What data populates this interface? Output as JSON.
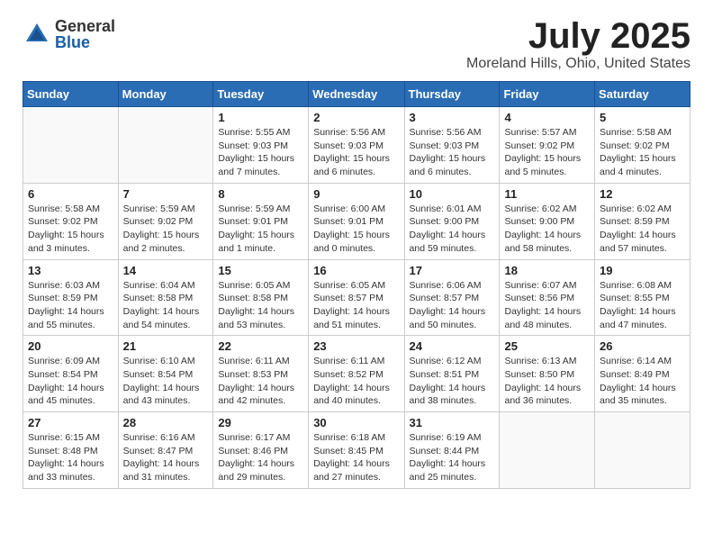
{
  "header": {
    "logo_general": "General",
    "logo_blue": "Blue",
    "month_title": "July 2025",
    "location": "Moreland Hills, Ohio, United States"
  },
  "weekdays": [
    "Sunday",
    "Monday",
    "Tuesday",
    "Wednesday",
    "Thursday",
    "Friday",
    "Saturday"
  ],
  "weeks": [
    [
      {
        "day": "",
        "info": ""
      },
      {
        "day": "",
        "info": ""
      },
      {
        "day": "1",
        "info": "Sunrise: 5:55 AM\nSunset: 9:03 PM\nDaylight: 15 hours and 7 minutes."
      },
      {
        "day": "2",
        "info": "Sunrise: 5:56 AM\nSunset: 9:03 PM\nDaylight: 15 hours and 6 minutes."
      },
      {
        "day": "3",
        "info": "Sunrise: 5:56 AM\nSunset: 9:03 PM\nDaylight: 15 hours and 6 minutes."
      },
      {
        "day": "4",
        "info": "Sunrise: 5:57 AM\nSunset: 9:02 PM\nDaylight: 15 hours and 5 minutes."
      },
      {
        "day": "5",
        "info": "Sunrise: 5:58 AM\nSunset: 9:02 PM\nDaylight: 15 hours and 4 minutes."
      }
    ],
    [
      {
        "day": "6",
        "info": "Sunrise: 5:58 AM\nSunset: 9:02 PM\nDaylight: 15 hours and 3 minutes."
      },
      {
        "day": "7",
        "info": "Sunrise: 5:59 AM\nSunset: 9:02 PM\nDaylight: 15 hours and 2 minutes."
      },
      {
        "day": "8",
        "info": "Sunrise: 5:59 AM\nSunset: 9:01 PM\nDaylight: 15 hours and 1 minute."
      },
      {
        "day": "9",
        "info": "Sunrise: 6:00 AM\nSunset: 9:01 PM\nDaylight: 15 hours and 0 minutes."
      },
      {
        "day": "10",
        "info": "Sunrise: 6:01 AM\nSunset: 9:00 PM\nDaylight: 14 hours and 59 minutes."
      },
      {
        "day": "11",
        "info": "Sunrise: 6:02 AM\nSunset: 9:00 PM\nDaylight: 14 hours and 58 minutes."
      },
      {
        "day": "12",
        "info": "Sunrise: 6:02 AM\nSunset: 8:59 PM\nDaylight: 14 hours and 57 minutes."
      }
    ],
    [
      {
        "day": "13",
        "info": "Sunrise: 6:03 AM\nSunset: 8:59 PM\nDaylight: 14 hours and 55 minutes."
      },
      {
        "day": "14",
        "info": "Sunrise: 6:04 AM\nSunset: 8:58 PM\nDaylight: 14 hours and 54 minutes."
      },
      {
        "day": "15",
        "info": "Sunrise: 6:05 AM\nSunset: 8:58 PM\nDaylight: 14 hours and 53 minutes."
      },
      {
        "day": "16",
        "info": "Sunrise: 6:05 AM\nSunset: 8:57 PM\nDaylight: 14 hours and 51 minutes."
      },
      {
        "day": "17",
        "info": "Sunrise: 6:06 AM\nSunset: 8:57 PM\nDaylight: 14 hours and 50 minutes."
      },
      {
        "day": "18",
        "info": "Sunrise: 6:07 AM\nSunset: 8:56 PM\nDaylight: 14 hours and 48 minutes."
      },
      {
        "day": "19",
        "info": "Sunrise: 6:08 AM\nSunset: 8:55 PM\nDaylight: 14 hours and 47 minutes."
      }
    ],
    [
      {
        "day": "20",
        "info": "Sunrise: 6:09 AM\nSunset: 8:54 PM\nDaylight: 14 hours and 45 minutes."
      },
      {
        "day": "21",
        "info": "Sunrise: 6:10 AM\nSunset: 8:54 PM\nDaylight: 14 hours and 43 minutes."
      },
      {
        "day": "22",
        "info": "Sunrise: 6:11 AM\nSunset: 8:53 PM\nDaylight: 14 hours and 42 minutes."
      },
      {
        "day": "23",
        "info": "Sunrise: 6:11 AM\nSunset: 8:52 PM\nDaylight: 14 hours and 40 minutes."
      },
      {
        "day": "24",
        "info": "Sunrise: 6:12 AM\nSunset: 8:51 PM\nDaylight: 14 hours and 38 minutes."
      },
      {
        "day": "25",
        "info": "Sunrise: 6:13 AM\nSunset: 8:50 PM\nDaylight: 14 hours and 36 minutes."
      },
      {
        "day": "26",
        "info": "Sunrise: 6:14 AM\nSunset: 8:49 PM\nDaylight: 14 hours and 35 minutes."
      }
    ],
    [
      {
        "day": "27",
        "info": "Sunrise: 6:15 AM\nSunset: 8:48 PM\nDaylight: 14 hours and 33 minutes."
      },
      {
        "day": "28",
        "info": "Sunrise: 6:16 AM\nSunset: 8:47 PM\nDaylight: 14 hours and 31 minutes."
      },
      {
        "day": "29",
        "info": "Sunrise: 6:17 AM\nSunset: 8:46 PM\nDaylight: 14 hours and 29 minutes."
      },
      {
        "day": "30",
        "info": "Sunrise: 6:18 AM\nSunset: 8:45 PM\nDaylight: 14 hours and 27 minutes."
      },
      {
        "day": "31",
        "info": "Sunrise: 6:19 AM\nSunset: 8:44 PM\nDaylight: 14 hours and 25 minutes."
      },
      {
        "day": "",
        "info": ""
      },
      {
        "day": "",
        "info": ""
      }
    ]
  ]
}
